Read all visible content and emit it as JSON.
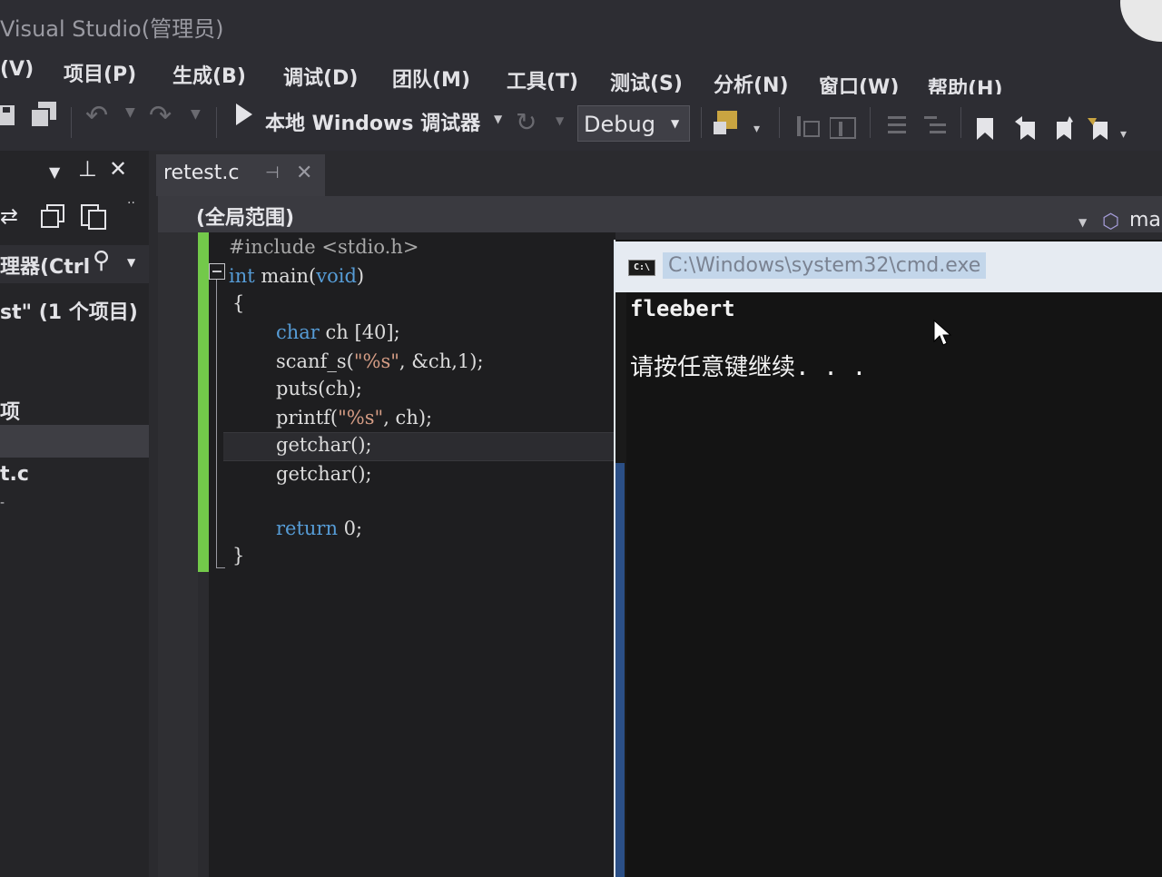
{
  "window": {
    "title": "Visual Studio(管理员)"
  },
  "menu": {
    "items": [
      {
        "label": "(V)"
      },
      {
        "label": "项目(P)"
      },
      {
        "label": "生成(B)"
      },
      {
        "label": "调试(D)"
      },
      {
        "label": "团队(M)"
      },
      {
        "label": "工具(T)"
      },
      {
        "label": "测试(S)"
      },
      {
        "label": "分析(N)"
      },
      {
        "label": "窗口(W)"
      },
      {
        "label": "帮助(H)"
      }
    ]
  },
  "toolbar": {
    "run_target": "本地 Windows 调试器",
    "configuration": "Debug"
  },
  "left_panel": {
    "search_label": "理器(Ctrl",
    "solution_label": "st\" (1 个项目)",
    "item_project": "项",
    "item_file": "t.c"
  },
  "tabs": [
    {
      "label": "retest.c",
      "active": true
    }
  ],
  "navbar": {
    "scope": "(全局范围)",
    "member": "mai"
  },
  "code": {
    "line1_pp": "#include <stdio.h>",
    "line2_kw1": "int",
    "line2_rest": " main(",
    "line2_kw2": "void",
    "line2_end": ")",
    "line3": "{",
    "line4_kw": "char",
    "line4_rest": " ch [40];",
    "line5_a": "scanf_s(",
    "line5_str": "\"%s\"",
    "line5_b": ", &ch,1);",
    "line6": "puts(ch);",
    "line7_a": "printf(",
    "line7_str": "\"%s\"",
    "line7_b": ", ch);",
    "line8": "getchar();",
    "line9": "getchar();",
    "line10_kw": "return",
    "line10_rest": " 0;",
    "line11": "}"
  },
  "console": {
    "title": "C:\\Windows\\system32\\cmd.exe",
    "output_line1": "fleebert",
    "output_line2": "请按任意键继续. . ."
  }
}
